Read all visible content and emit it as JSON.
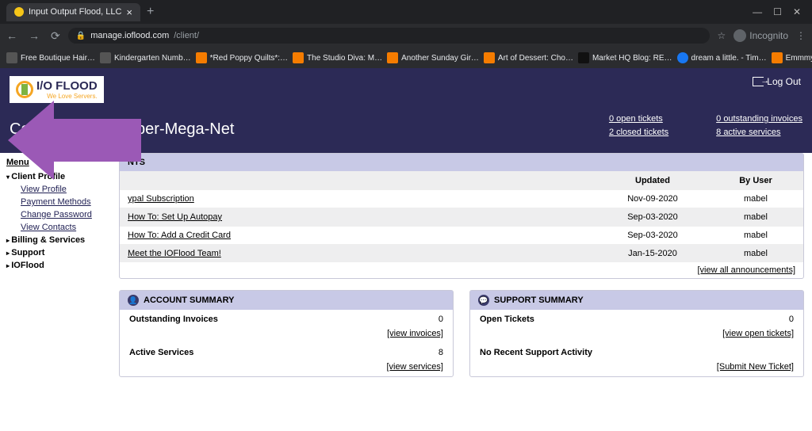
{
  "browser": {
    "tab_title": "Input Output Flood, LLC",
    "url_host": "manage.ioflood.com",
    "url_path": "/client/",
    "incognito_label": "Incognito",
    "bookmarks": [
      "Free Boutique Hair…",
      "Kindergarten Numb…",
      "*Red Poppy Quilts*:…",
      "The Studio Diva: M…",
      "Another Sunday Gir…",
      "Art of Dessert: Cho…",
      "Market HQ Blog: RE…",
      "dream a little. - Tim…",
      "EmmmyLizzzy: Hav…"
    ]
  },
  "header": {
    "logo_main": "I/O FLOOD",
    "logo_sub": "We Love Servers.",
    "client_name": "Compu-Global-Hyper-Mega-Net",
    "logout": "Log Out",
    "stats": {
      "open_tickets": "0 open tickets",
      "closed_tickets": "2 closed tickets",
      "outstanding_invoices": "0 outstanding invoices",
      "active_services": "8 active services"
    }
  },
  "sidebar": {
    "menu": "Menu",
    "items": [
      {
        "label": "Client Profile",
        "expanded": true
      },
      {
        "label": "Billing & Services",
        "expanded": false
      },
      {
        "label": "Support",
        "expanded": false
      },
      {
        "label": "IOFlood",
        "expanded": false
      }
    ],
    "profile_sub": [
      "View Profile",
      "Payment Methods",
      "Change Password",
      "View Contacts"
    ]
  },
  "announcements": {
    "title": "NTS",
    "cols": {
      "updated": "Updated",
      "by_user": "By User"
    },
    "rows": [
      {
        "title": "ypal Subscription",
        "date": "Nov-09-2020",
        "user": "mabel"
      },
      {
        "title": "How To: Set Up Autopay",
        "date": "Sep-03-2020",
        "user": "mabel"
      },
      {
        "title": "How To: Add a Credit Card",
        "date": "Sep-03-2020",
        "user": "mabel"
      },
      {
        "title": "Meet the IOFlood Team!",
        "date": "Jan-15-2020",
        "user": "mabel"
      }
    ],
    "view_all": "[view all announcements]"
  },
  "account_summary": {
    "title": "ACCOUNT SUMMARY",
    "rows": [
      {
        "label": "Outstanding Invoices",
        "value": "0",
        "link": "[view invoices]"
      },
      {
        "label": "Active Services",
        "value": "8",
        "link": "[view services]"
      }
    ]
  },
  "support_summary": {
    "title": "SUPPORT SUMMARY",
    "open_label": "Open Tickets",
    "open_value": "0",
    "open_link": "[view open tickets]",
    "no_activity": "No Recent Support Activity",
    "submit_link": "[Submit New Ticket]"
  }
}
